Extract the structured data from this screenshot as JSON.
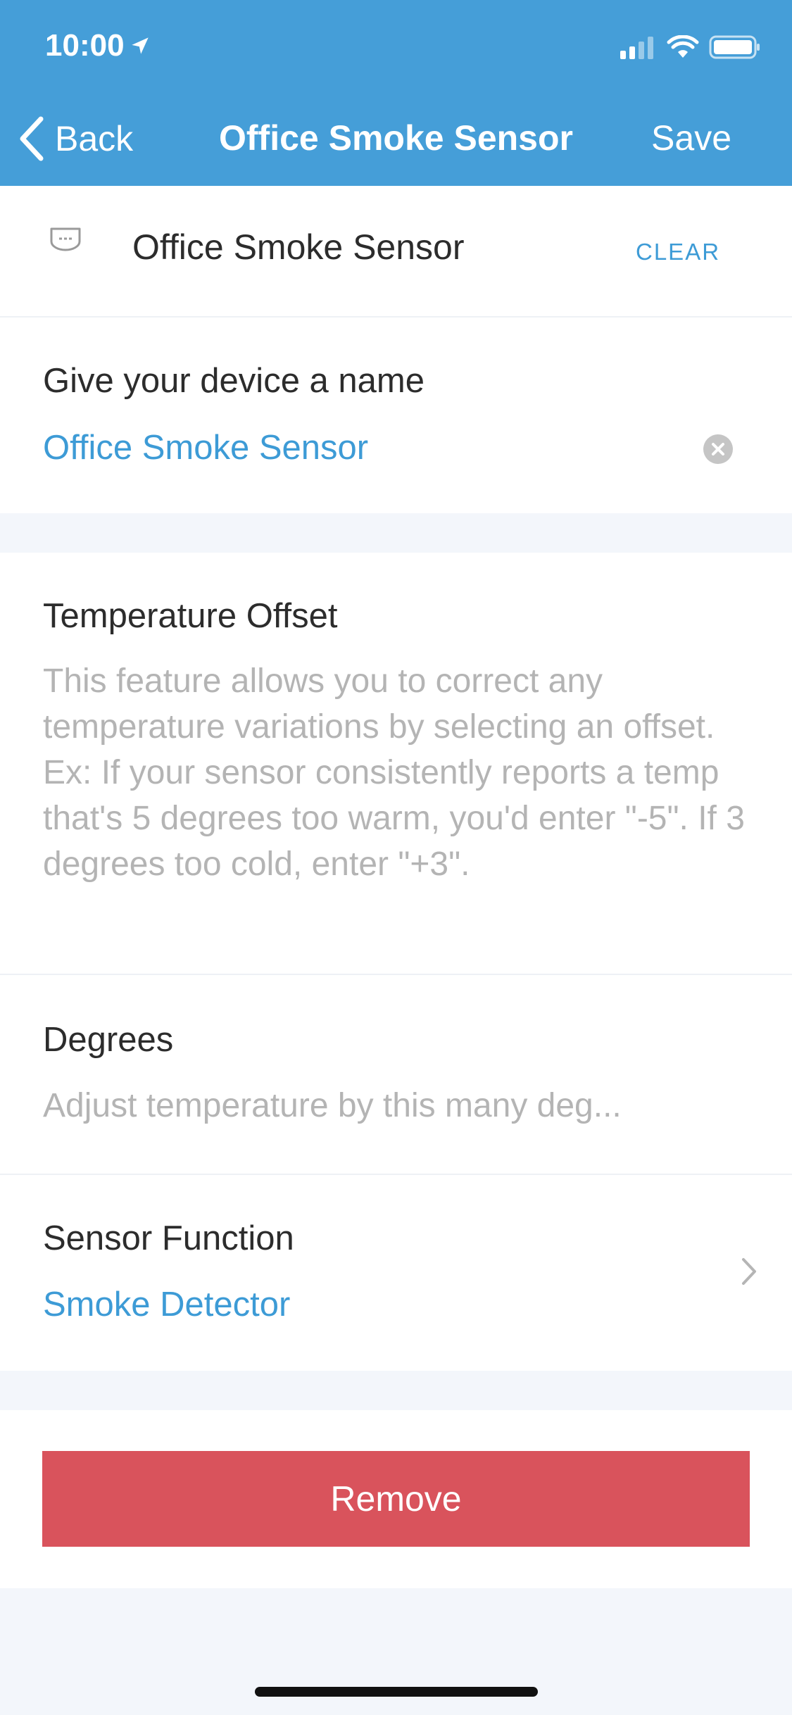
{
  "status_bar": {
    "time": "10:00"
  },
  "nav": {
    "back_label": "Back",
    "title": "Office Smoke Sensor",
    "save_label": "Save"
  },
  "device_row": {
    "name": "Office Smoke Sensor",
    "clear_label": "CLEAR"
  },
  "name_field": {
    "label": "Give your device a name",
    "value": "Office Smoke Sensor"
  },
  "temp_offset": {
    "title": "Temperature Offset",
    "description": "This feature allows you to correct any temperature variations by selecting an offset. Ex: If your sensor consistently reports a temp that's 5 degrees too warm, you'd enter \"-5\". If 3 degrees too cold, enter \"+3\"."
  },
  "degrees": {
    "label": "Degrees",
    "placeholder": "Adjust temperature by this many deg..."
  },
  "sensor_function": {
    "label": "Sensor Function",
    "value": "Smoke Detector"
  },
  "remove_label": "Remove",
  "colors": {
    "header_bg": "#459ed8",
    "accent": "#3d9bd6",
    "danger": "#d9535c"
  },
  "icons": [
    "location-arrow-icon",
    "signal-icon",
    "wifi-icon",
    "battery-icon",
    "chevron-left-icon",
    "smoke-sensor-icon",
    "clear-circle-icon",
    "chevron-right-icon"
  ]
}
